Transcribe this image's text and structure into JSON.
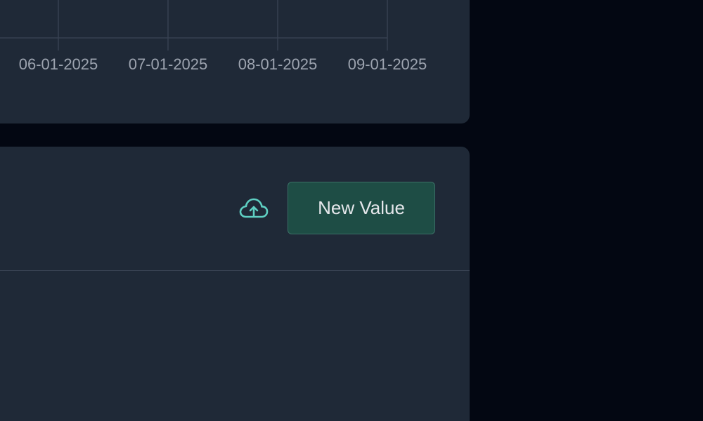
{
  "chart": {
    "x_ticks": [
      "06-01-2025",
      "07-01-2025",
      "08-01-2025",
      "09-01-2025"
    ]
  },
  "toolbar": {
    "upload_icon": "cloud-upload-icon",
    "new_value_label": "New Value"
  },
  "colors": {
    "background": "#030712",
    "card": "#1f2937",
    "accent": "#5fd0c3",
    "button_bg": "#1e4d45",
    "grid": "#374151",
    "tick_text": "#9ca3af"
  },
  "chart_data": {
    "type": "line",
    "title": "",
    "xlabel": "",
    "ylabel": "",
    "x": [
      "06-01-2025",
      "07-01-2025",
      "08-01-2025",
      "09-01-2025"
    ],
    "series": [],
    "grid": true
  }
}
